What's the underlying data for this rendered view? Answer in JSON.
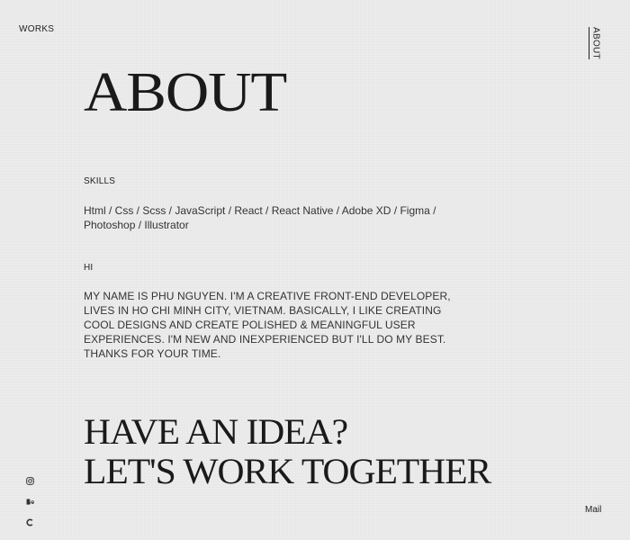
{
  "nav": {
    "works": "WORKS",
    "about": "ABOUT"
  },
  "page_title": "ABOUT",
  "skills": {
    "label": "SKILLS",
    "list": "Html / Css / Scss / JavaScript / React / React Native / Adobe XD / Figma / Photoshop / Illustrator"
  },
  "intro": {
    "label": "HI",
    "bio": "MY NAME IS PHU NGUYEN. I'M A CREATIVE FRONT-END DEVELOPER, LIVES IN HO CHI MINH CITY, VIETNAM. BASICALLY, I LIKE CREATING COOL DESIGNS AND CREATE POLISHED & MEANINGFUL USER EXPERIENCES. I'M NEW AND INEXPERIENCED BUT I'LL DO MY BEST. THANKS FOR YOUR TIME."
  },
  "cta": {
    "line1": "HAVE AN IDEA?",
    "line2": "LET'S WORK TOGETHER"
  },
  "social_icons": [
    "instagram-icon",
    "behance-icon",
    "codepen-icon"
  ],
  "mail_label": "Mail"
}
